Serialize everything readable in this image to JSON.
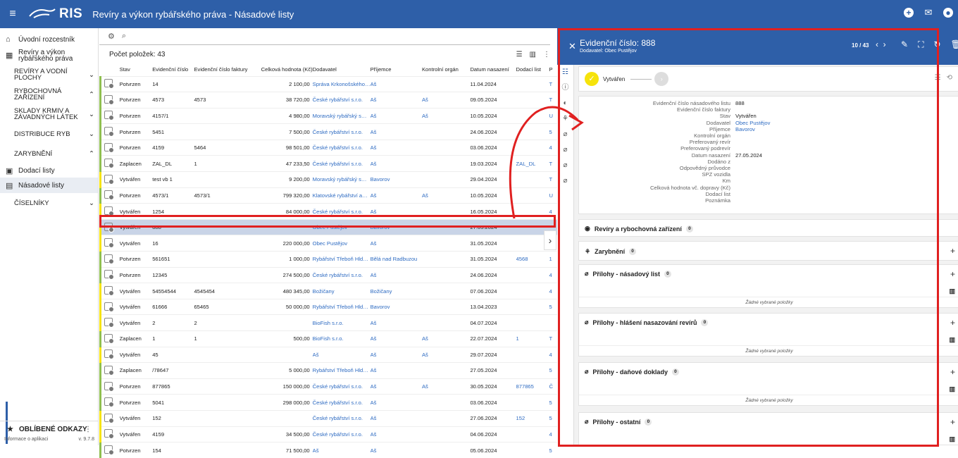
{
  "app": {
    "logo_text": "RIS",
    "title": "Revíry a výkon rybářského práva - Násadové listy"
  },
  "sidebar": {
    "items": [
      {
        "label": "Úvodní rozcestník",
        "icon": "home-icon"
      },
      {
        "label": "Revíry a výkon rybářského práva",
        "icon": "grid-icon"
      }
    ],
    "categories": [
      {
        "label": "REVÍRY A VODNÍ PLOCHY",
        "chevron": "⌄"
      },
      {
        "label": "RYBOCHOVNÁ ZAŘÍZENÍ",
        "chevron": "⌃"
      },
      {
        "label": "SKLADY KRMIV A ZÁVADNÝCH LÁTEK",
        "chevron": "⌄"
      },
      {
        "label": "DISTRIBUCE RYB",
        "chevron": "⌄"
      },
      {
        "label": "ZARYBNĚNÍ",
        "chevron": "⌃"
      }
    ],
    "sub": [
      {
        "label": "Dodací listy"
      },
      {
        "label": "Násadové listy"
      }
    ],
    "ciselniky": "ČÍSELNÍKY",
    "favorites": "OBLÍBENÉ ODKAZY",
    "footer_left": "Informace o aplikaci",
    "footer_right": "v. 9.7.8"
  },
  "list": {
    "count_label": "Počet položek: 43",
    "columns": [
      "Stav",
      "Evidenční číslo",
      "Evidenční číslo faktury",
      "Celková hodnota (Kč)",
      "Dodavatel",
      "Příjemce",
      "Kontrolní orgán",
      "Datum nasazení",
      "Dodací list",
      "P"
    ],
    "rows": [
      [
        "Potvrzen",
        "14",
        "",
        "2 100,00",
        "Správa Krkonošského…",
        "Aš",
        "",
        "11.04.2024",
        "",
        "T"
      ],
      [
        "Potvrzen",
        "4573",
        "4573",
        "38 720,00",
        "České rybářství s.r.o.",
        "Aš",
        "Aš",
        "09.05.2024",
        "",
        "T"
      ],
      [
        "Potvrzen",
        "4157/1",
        "",
        "4 980,00",
        "Moravský rybářský s…",
        "Aš",
        "Aš",
        "10.05.2024",
        "",
        "U"
      ],
      [
        "Potvrzen",
        "5451",
        "",
        "7 500,00",
        "České rybářství s.r.o.",
        "Aš",
        "",
        "24.06.2024",
        "",
        "5"
      ],
      [
        "Potvrzen",
        "4159",
        "5464",
        "98 501,00",
        "České rybářství s.r.o.",
        "Aš",
        "",
        "03.06.2024",
        "",
        "4"
      ],
      [
        "Zaplacen",
        "ZAL_DL",
        "1",
        "47 233,50",
        "České rybářství s.r.o.",
        "Aš",
        "",
        "19.03.2024",
        "ZAL_DL",
        "T"
      ],
      [
        "Vytvářen",
        "test vb 1",
        "",
        "9 200,00",
        "Moravský rybářský s…",
        "Bavorov",
        "",
        "29.04.2024",
        "",
        "T"
      ],
      [
        "Potvrzen",
        "4573/1",
        "4573/1",
        "799 320,00",
        "Klatovské rybářství a…",
        "Aš",
        "Aš",
        "10.05.2024",
        "",
        "U"
      ],
      [
        "Vytvářen",
        "1254",
        "",
        "84 000,00",
        "České rybářství s.r.o.",
        "Aš",
        "",
        "16.05.2024",
        "",
        "4"
      ],
      [
        "Vytvářen",
        "888",
        "",
        "",
        "Obec Pustějov",
        "Bavorov",
        "",
        "27.05.2024",
        "",
        ""
      ],
      [
        "Vytvářen",
        "16",
        "",
        "220 000,00",
        "Obec Pustějov",
        "Aš",
        "",
        "31.05.2024",
        "",
        ""
      ],
      [
        "Potvrzen",
        "561651",
        "",
        "1 000,00",
        "Rybářství Třeboň Hld…",
        "Bělá nad Radbuzou",
        "",
        "31.05.2024",
        "4568",
        "1"
      ],
      [
        "Potvrzen",
        "12345",
        "",
        "274 500,00",
        "České rybářství s.r.o.",
        "Aš",
        "",
        "24.06.2024",
        "",
        "4"
      ],
      [
        "Vytvářen",
        "54554544",
        "4545454",
        "480 345,00",
        "Božičany",
        "Božičany",
        "",
        "07.06.2024",
        "",
        "4"
      ],
      [
        "Vytvářen",
        "61666",
        "65465",
        "50 000,00",
        "Rybářství Třeboň Hld…",
        "Bavorov",
        "",
        "13.04.2023",
        "",
        "5"
      ],
      [
        "Vytvářen",
        "2",
        "2",
        "",
        "BioFish s.r.o.",
        "Aš",
        "",
        "04.07.2024",
        "",
        ""
      ],
      [
        "Zaplacen",
        "1",
        "1",
        "500,00",
        "BioFish s.r.o.",
        "Aš",
        "Aš",
        "22.07.2024",
        "1",
        "T"
      ],
      [
        "Vytvářen",
        "45",
        "",
        "",
        "Aš",
        "Aš",
        "Aš",
        "29.07.2024",
        "",
        "4"
      ],
      [
        "Zaplacen",
        "/78647",
        "",
        "5 000,00",
        "Rybářství Třeboň Hld…",
        "Aš",
        "",
        "27.05.2024",
        "",
        "5"
      ],
      [
        "Potvrzen",
        "877865",
        "",
        "150 000,00",
        "České rybářství s.r.o.",
        "Aš",
        "Aš",
        "30.05.2024",
        "877865",
        "Č"
      ],
      [
        "Potvrzen",
        "5041",
        "",
        "298 000,00",
        "České rybářství s.r.o.",
        "Aš",
        "",
        "03.06.2024",
        "",
        "5"
      ],
      [
        "Vytvářen",
        "152",
        "",
        "",
        "České rybářství s.r.o.",
        "Aš",
        "",
        "27.06.2024",
        "152",
        "5"
      ],
      [
        "Vytvářen",
        "4159",
        "",
        "34 500,00",
        "České rybářství s.r.o.",
        "Aš",
        "",
        "04.06.2024",
        "",
        "4"
      ],
      [
        "Potvrzen",
        "154",
        "",
        "71 500,00",
        "Aš",
        "Aš",
        "",
        "05.06.2024",
        "",
        "5"
      ]
    ]
  },
  "detail": {
    "title": "Evidenční číslo: 888",
    "subtitle": "Dodavatel: Obec Pustějov",
    "paging": "10 / 43",
    "step_current": "Vytvářen",
    "fields": [
      {
        "k": "Evidenční číslo násadového listu",
        "v": "888"
      },
      {
        "k": "Evidenční číslo faktury",
        "v": ""
      },
      {
        "k": "Stav",
        "v": "Vytvářen"
      },
      {
        "k": "Dodavatel",
        "v": "Obec Pustějov"
      },
      {
        "k": "Příjemce",
        "v": "Bavorov"
      },
      {
        "k": "Kontrolní orgán",
        "v": ""
      },
      {
        "k": "Preferovaný revír",
        "v": ""
      },
      {
        "k": "Preferovaný podrevír",
        "v": ""
      },
      {
        "k": "Datum nasazení",
        "v": "27.05.2024"
      },
      {
        "k": "Dodáno z",
        "v": ""
      },
      {
        "k": "Odpovědný průvodce",
        "v": ""
      },
      {
        "k": "SPZ vozidla",
        "v": ""
      },
      {
        "k": "Km",
        "v": ""
      },
      {
        "k": "Celková hodnota vč. dopravy (Kč)",
        "v": ""
      },
      {
        "k": "Dodací list",
        "v": ""
      },
      {
        "k": "Poznámka",
        "v": ""
      }
    ],
    "sections": [
      {
        "label": "Revíry a rybochovná zařízení",
        "count": "0"
      },
      {
        "label": "Zarybnění",
        "count": "0"
      },
      {
        "label": "Přílohy - násadový list",
        "count": "0",
        "empty": "Žádné vybrané položky"
      },
      {
        "label": "Přílohy - hlášení nasazování revírů",
        "count": "0",
        "empty": "Žádné vybrané položky"
      },
      {
        "label": "Přílohy - daňové doklady",
        "count": "0",
        "empty": "Žádné vybrané položky"
      },
      {
        "label": "Přílohy - ostatní",
        "count": "0"
      }
    ]
  },
  "colors": {
    "brand": "#2e5fa8",
    "highlight": "#e02020",
    "link": "#2e6bc2",
    "status_yellow": "#f6e30b",
    "status_green": "#8fbf4f"
  }
}
